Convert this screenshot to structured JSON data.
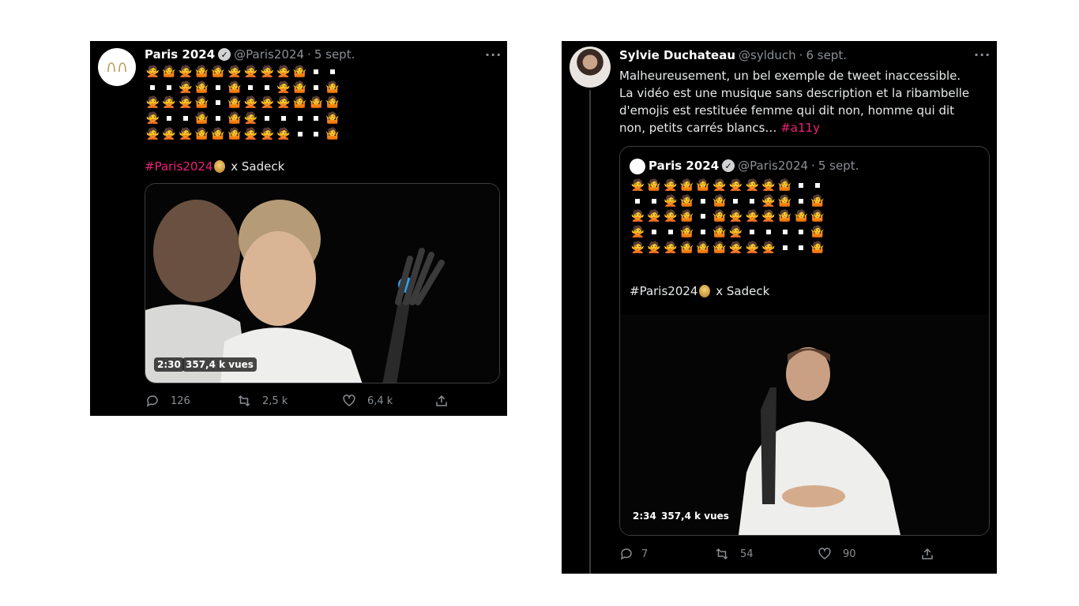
{
  "tweet_paris": {
    "name": "Paris 2024",
    "handle": "@Paris2024",
    "separator": "·",
    "date": "5 sept.",
    "more": "···",
    "emoji_rows": [
      [
        "w",
        "m",
        "w",
        "m",
        "m",
        "w",
        "w",
        "w",
        "w",
        "m",
        "sq",
        "sq"
      ],
      [
        "sq",
        "sq",
        "w",
        "m",
        "sq",
        "m",
        "sq",
        "sq",
        "w",
        "m",
        "sq",
        "m"
      ],
      [
        "w",
        "w",
        "w",
        "m",
        "sq",
        "m",
        "w",
        "w",
        "w",
        "m",
        "m",
        "m"
      ],
      [
        "w",
        "sq",
        "sq",
        "m",
        "sq",
        "m",
        "w",
        "sq",
        "sq",
        "sq",
        "sq",
        "m"
      ],
      [
        "w",
        "w",
        "w",
        "m",
        "m",
        "m",
        "w",
        "w",
        "w",
        "sq",
        "sq",
        "m"
      ]
    ],
    "hashtag": "#Paris2024",
    "hashtag_suffix": "x Sadeck",
    "video_duration": "2:30",
    "video_views": "357,4 k vues",
    "replies": "126",
    "retweets": "2,5 k",
    "likes": "6,4 k"
  },
  "tweet_sylvie": {
    "name": "Sylvie Duchateau",
    "handle": "@sylduch",
    "separator": "·",
    "date": "6 sept.",
    "more": "···",
    "text_line1": "Malheureusement, un bel exemple de tweet inaccessible.",
    "text_line2": "La vidéo est une musique sans description et la ribambelle d'emojis est restituée femme qui dit non, homme qui dit non, petits carrés blancs…",
    "text_tag": "#a11y",
    "quote": {
      "name": "Paris 2024",
      "handle": "@Paris2024",
      "separator": "·",
      "date": "5 sept.",
      "hashtag": "#Paris2024",
      "hashtag_suffix": "x Sadeck",
      "video_duration": "2:34",
      "video_views": "357,4 k vues"
    },
    "replies": "7",
    "retweets": "54",
    "likes": "90"
  },
  "icons": {
    "verified": "verified-badge-icon",
    "reply": "reply-icon",
    "retweet": "retweet-icon",
    "like": "heart-icon",
    "share": "share-icon",
    "verified_glyph": "✓"
  },
  "colors": {
    "background": "#000000",
    "hashtag": "#f01f7c",
    "muted": "#8b8f94",
    "border": "#3a3d40"
  }
}
